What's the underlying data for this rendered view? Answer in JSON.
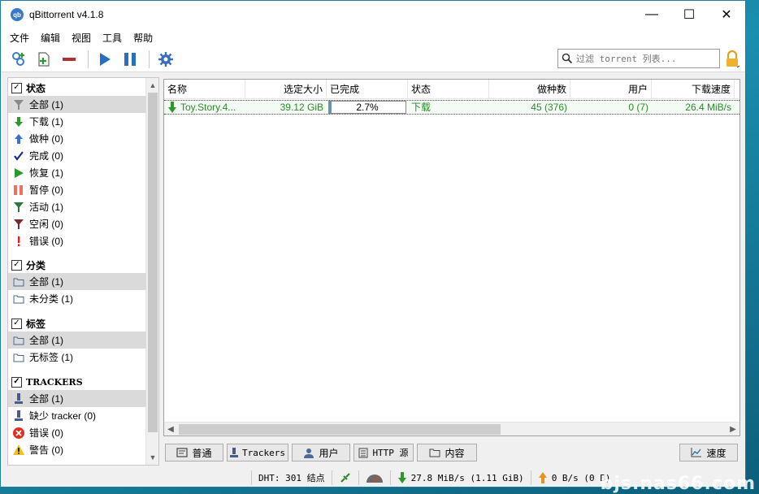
{
  "window": {
    "title": "qBittorrent v4.1.8",
    "app_icon_text": "qb",
    "controls": {
      "minimize": "—",
      "maximize": "☐",
      "close": "✕"
    }
  },
  "menu": [
    "文件",
    "编辑",
    "视图",
    "工具",
    "帮助"
  ],
  "toolbar": {
    "buttons": [
      "add-torrent-link-icon",
      "add-torrent-file-icon",
      "remove-icon",
      "resume-icon",
      "pause-icon",
      "settings-icon"
    ],
    "search_placeholder": "过滤 torrent 列表...",
    "accent_color": "#3a7fc8"
  },
  "sidebar": {
    "status": {
      "title": "状态",
      "items": [
        {
          "label": "全部 (1)",
          "icon": "filter-icon",
          "color": "#8a8a8a"
        },
        {
          "label": "下载 (1)",
          "icon": "arrow-down-icon",
          "color": "#2a9a2a"
        },
        {
          "label": "做种 (0)",
          "icon": "arrow-up-icon",
          "color": "#3a6fd8"
        },
        {
          "label": "完成 (0)",
          "icon": "check-icon",
          "color": "#1a2a8a"
        },
        {
          "label": "恢复 (1)",
          "icon": "play-icon",
          "color": "#2a9a2a"
        },
        {
          "label": "暂停 (0)",
          "icon": "pause-icon",
          "color": "#f07060"
        },
        {
          "label": "活动 (1)",
          "icon": "filter-icon",
          "color": "#2a7a3a"
        },
        {
          "label": "空闲 (0)",
          "icon": "filter-icon",
          "color": "#7a2a2a"
        },
        {
          "label": "错误 (0)",
          "icon": "exclamation-icon",
          "color": "#e02020"
        }
      ]
    },
    "categories": {
      "title": "分类",
      "items": [
        {
          "label": "全部 (1)",
          "icon": "folder-icon"
        },
        {
          "label": "未分类 (1)",
          "icon": "folder-icon"
        }
      ]
    },
    "tags": {
      "title": "标签",
      "items": [
        {
          "label": "全部 (1)",
          "icon": "folder-icon"
        },
        {
          "label": "无标签 (1)",
          "icon": "folder-icon"
        }
      ]
    },
    "trackers": {
      "title": "TRACKERS",
      "items": [
        {
          "label": "全部 (1)",
          "icon": "tracker-icon"
        },
        {
          "label": "缺少 tracker (0)",
          "icon": "tracker-icon"
        },
        {
          "label": "错误 (0)",
          "icon": "error-circle-icon"
        },
        {
          "label": "警告 (0)",
          "icon": "warning-icon"
        }
      ]
    }
  },
  "table": {
    "columns": [
      "名称",
      "选定大小",
      "已完成",
      "状态",
      "做种数",
      "用户",
      "下载速度"
    ],
    "rows": [
      {
        "name": "Toy.Story.4...",
        "size": "39.12 GiB",
        "progress_text": "2.7%",
        "progress": 0.027,
        "status": "下载",
        "seeds": "45 (376)",
        "peers": "0 (7)",
        "dl_speed": "26.4 MiB/s"
      }
    ],
    "row_text_color": "#2a8a2a"
  },
  "bottom_tabs": [
    "普通",
    "Trackers",
    "用户",
    "HTTP 源",
    "内容"
  ],
  "speed_button": "速度",
  "statusbar": {
    "dht": "DHT: 301 结点",
    "download": "27.8  MiB/s (1.11  GiB)",
    "upload": "0  B/s (0  B)"
  },
  "watermark": "bjs.nas66.com"
}
